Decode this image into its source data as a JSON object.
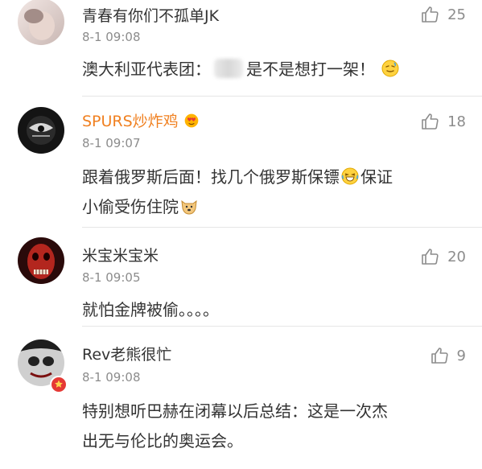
{
  "comments": [
    {
      "username": "青春有你们不孤单JK",
      "time": "8-1 09:08",
      "likes": "25",
      "text_prefix": "澳大利亚代表团：",
      "text_suffix": "是不是想打一架！"
    },
    {
      "username": "SPURS炒炸鸡",
      "time": "8-1 09:07",
      "likes": "18",
      "text_line1_a": "跟着俄罗斯后面！找几个俄罗斯保镖",
      "text_line1_b": "保证",
      "text_line2": "小偷受伤住院"
    },
    {
      "username": "米宝米宝米",
      "time": "8-1 09:05",
      "likes": "20",
      "text": "就怕金牌被偷。。。。"
    },
    {
      "username": "Rev老熊很忙",
      "time": "8-1 09:08",
      "likes": "9",
      "text_line1": "特别想听巴赫在闭幕以后总结：这是一次杰",
      "text_line2": "出无与伦比的奥运会。"
    }
  ],
  "colors": {
    "username_vip": "#f08020",
    "username": "#333333",
    "meta": "#8c8c8c",
    "divider": "#e6e6e6"
  },
  "icons": {
    "like": "thumbs-up-outline-icon",
    "vip": "heart-face-icon",
    "verified": "star-badge-icon"
  }
}
